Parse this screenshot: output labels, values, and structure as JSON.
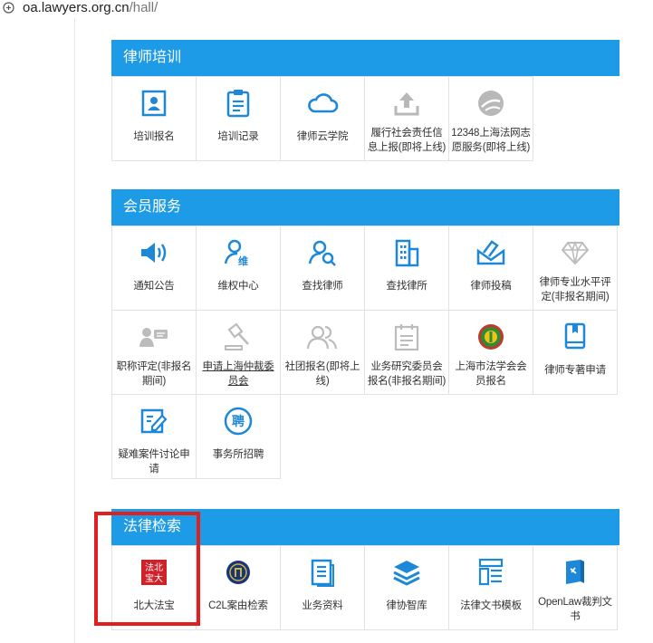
{
  "urlbar": {
    "host": "oa.lawyers.org.cn",
    "path": "/hall/",
    "site_icon": "site-info-icon"
  },
  "colors": {
    "header_bg": "#1e9be6",
    "icon_blue": "#1e88d8",
    "icon_gray": "#b0b0b0",
    "highlight": "#e02020"
  },
  "sections": {
    "training": {
      "title": "律师培训",
      "tiles": [
        {
          "label": "培训报名",
          "icon": "id-card-icon"
        },
        {
          "label": "培训记录",
          "icon": "clipboard-icon"
        },
        {
          "label": "律师云学院",
          "icon": "cloud-icon"
        },
        {
          "label": "履行社会责任信息上报(即将上线)",
          "icon": "upload-icon"
        },
        {
          "label": "12348上海法网志愿服务(即将上线)",
          "icon": "globe-icon"
        }
      ]
    },
    "member": {
      "title": "会员服务",
      "tiles": [
        {
          "label": "通知公告",
          "icon": "megaphone-icon"
        },
        {
          "label": "维权中心",
          "icon": "rights-person-icon"
        },
        {
          "label": "查找律师",
          "icon": "person-search-icon"
        },
        {
          "label": "查找律所",
          "icon": "building-icon"
        },
        {
          "label": "律师投稿",
          "icon": "envelope-pen-icon"
        },
        {
          "label": "律师专业水平评定(非报名期间)",
          "icon": "diamond-icon"
        },
        {
          "label": "职称评定(非报名期间)",
          "icon": "person-card-icon"
        },
        {
          "label": "申请上海仲裁委员会",
          "icon": "gavel-icon"
        },
        {
          "label": "社团报名(即将上线)",
          "icon": "group-icon"
        },
        {
          "label": "业务研究委员会报名(非报名期间)",
          "icon": "calendar-note-icon"
        },
        {
          "label": "上海市法学会会员报名",
          "icon": "law-society-emblem-icon"
        },
        {
          "label": "律师专著申请",
          "icon": "book-icon"
        },
        {
          "label": "疑难案件讨论申请",
          "icon": "edit-doc-icon"
        },
        {
          "label": "事务所招聘",
          "icon": "recruit-icon"
        }
      ]
    },
    "legal": {
      "title": "法律检索",
      "tiles": [
        {
          "label": "北大法宝",
          "icon": "pkulaw-logo-icon",
          "logo_text": "法北宝大"
        },
        {
          "label": "C2L案由检索",
          "icon": "c2l-logo-icon"
        },
        {
          "label": "业务资料",
          "icon": "document-list-icon"
        },
        {
          "label": "律协智库",
          "icon": "layers-icon"
        },
        {
          "label": "法律文书模板",
          "icon": "template-icon"
        },
        {
          "label": "OpenLaw裁判文书",
          "icon": "openlaw-book-icon"
        }
      ]
    }
  }
}
